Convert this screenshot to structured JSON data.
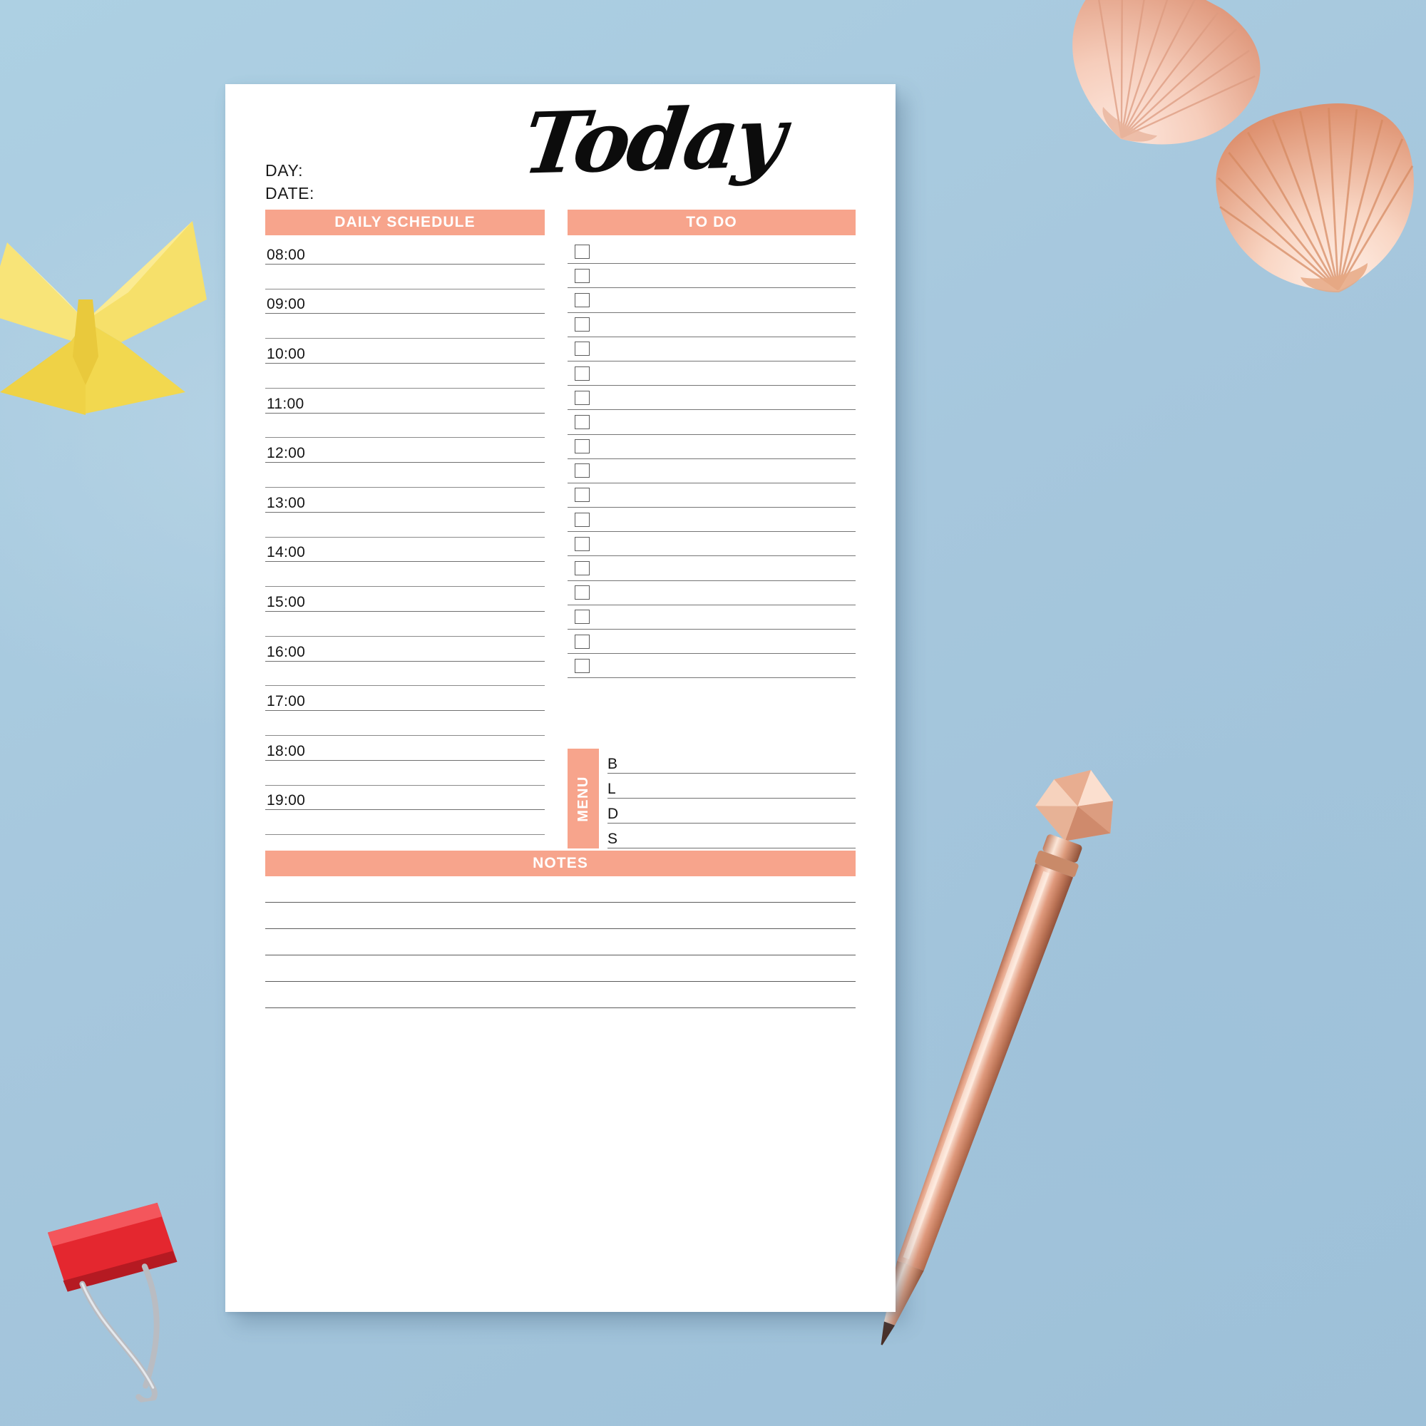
{
  "scene": {
    "background_color": "#a9c9de",
    "props": [
      {
        "name": "seashell-top",
        "label": "seashell"
      },
      {
        "name": "seashell-right",
        "label": "seashell"
      },
      {
        "name": "origami-butterfly",
        "label": "yellow origami butterfly"
      },
      {
        "name": "rose-gold-pen",
        "label": "rose gold ballpoint pen"
      },
      {
        "name": "binder-clip",
        "label": "red binder clip"
      }
    ]
  },
  "paper": {
    "background_color": "#ffffff",
    "accent_color": "#f7a48c",
    "title": "Today",
    "meta": {
      "day_label": "DAY:",
      "date_label": "DATE:"
    },
    "sections": {
      "schedule": {
        "header": "DAILY SCHEDULE",
        "rows": [
          {
            "time": "08:00",
            "half": false
          },
          {
            "time": "",
            "half": true
          },
          {
            "time": "09:00",
            "half": false
          },
          {
            "time": "",
            "half": true
          },
          {
            "time": "10:00",
            "half": false
          },
          {
            "time": "",
            "half": true
          },
          {
            "time": "11:00",
            "half": false
          },
          {
            "time": "",
            "half": true
          },
          {
            "time": "12:00",
            "half": false
          },
          {
            "time": "",
            "half": true
          },
          {
            "time": "13:00",
            "half": false
          },
          {
            "time": "",
            "half": true
          },
          {
            "time": "14:00",
            "half": false
          },
          {
            "time": "",
            "half": true
          },
          {
            "time": "15:00",
            "half": false
          },
          {
            "time": "",
            "half": true
          },
          {
            "time": "16:00",
            "half": false
          },
          {
            "time": "",
            "half": true
          },
          {
            "time": "17:00",
            "half": false
          },
          {
            "time": "",
            "half": true
          },
          {
            "time": "18:00",
            "half": false
          },
          {
            "time": "",
            "half": true
          },
          {
            "time": "19:00",
            "half": false
          },
          {
            "time": "",
            "half": true
          }
        ]
      },
      "todo": {
        "header": "TO DO",
        "item_count": 18,
        "items": [
          {
            "checked": false,
            "text": ""
          },
          {
            "checked": false,
            "text": ""
          },
          {
            "checked": false,
            "text": ""
          },
          {
            "checked": false,
            "text": ""
          },
          {
            "checked": false,
            "text": ""
          },
          {
            "checked": false,
            "text": ""
          },
          {
            "checked": false,
            "text": ""
          },
          {
            "checked": false,
            "text": ""
          },
          {
            "checked": false,
            "text": ""
          },
          {
            "checked": false,
            "text": ""
          },
          {
            "checked": false,
            "text": ""
          },
          {
            "checked": false,
            "text": ""
          },
          {
            "checked": false,
            "text": ""
          },
          {
            "checked": false,
            "text": ""
          },
          {
            "checked": false,
            "text": ""
          },
          {
            "checked": false,
            "text": ""
          },
          {
            "checked": false,
            "text": ""
          },
          {
            "checked": false,
            "text": ""
          }
        ]
      },
      "menu": {
        "header": "MENU",
        "rows": [
          {
            "key": "B",
            "value": ""
          },
          {
            "key": "L",
            "value": ""
          },
          {
            "key": "D",
            "value": ""
          },
          {
            "key": "S",
            "value": ""
          }
        ]
      },
      "notes": {
        "header": "NOTES",
        "line_count": 5,
        "lines": [
          "",
          "",
          "",
          "",
          ""
        ]
      }
    }
  }
}
